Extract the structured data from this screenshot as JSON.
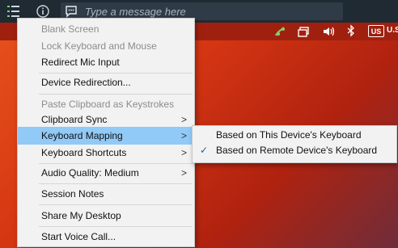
{
  "toolbar": {
    "menu_icon": "session-menu-icon",
    "info_icon": "info-icon",
    "chat_icon": "chat-icon",
    "message_placeholder": "Type a message here"
  },
  "tray": {
    "icons": [
      "network-status-icon",
      "display-icon",
      "volume-icon",
      "bluetooth-icon"
    ],
    "language_code": "US",
    "language_suffix": "U.S"
  },
  "menu": {
    "items": [
      {
        "label": "Blank Screen",
        "disabled": true
      },
      {
        "label": "Lock Keyboard and Mouse",
        "disabled": true
      },
      {
        "label": "Redirect Mic Input",
        "disabled": false
      },
      {
        "label": "Device Redirection...",
        "disabled": false
      },
      {
        "label": "Paste Clipboard as Keystrokes",
        "disabled": true
      },
      {
        "label": "Clipboard Sync",
        "disabled": false
      },
      {
        "label": "Keyboard Mapping",
        "disabled": false,
        "active": true
      },
      {
        "label": "Keyboard Shortcuts",
        "disabled": false
      },
      {
        "label": "Audio Quality: Medium",
        "disabled": false
      },
      {
        "label": "Session Notes",
        "disabled": false
      },
      {
        "label": "Share My Desktop",
        "disabled": false
      },
      {
        "label": "Start Voice Call...",
        "disabled": false
      }
    ],
    "chevron": ">"
  },
  "submenu": {
    "items": [
      {
        "label": "Based on This Device's Keyboard",
        "checked": false
      },
      {
        "label": "Based on Remote Device's Keyboard",
        "checked": true
      }
    ],
    "check_glyph": "✓"
  },
  "colors": {
    "toolbar_bg": "#1f2a33",
    "highlight": "#91c9f7",
    "menu_bg": "#f2f2f2",
    "desktop": "#d43512"
  }
}
